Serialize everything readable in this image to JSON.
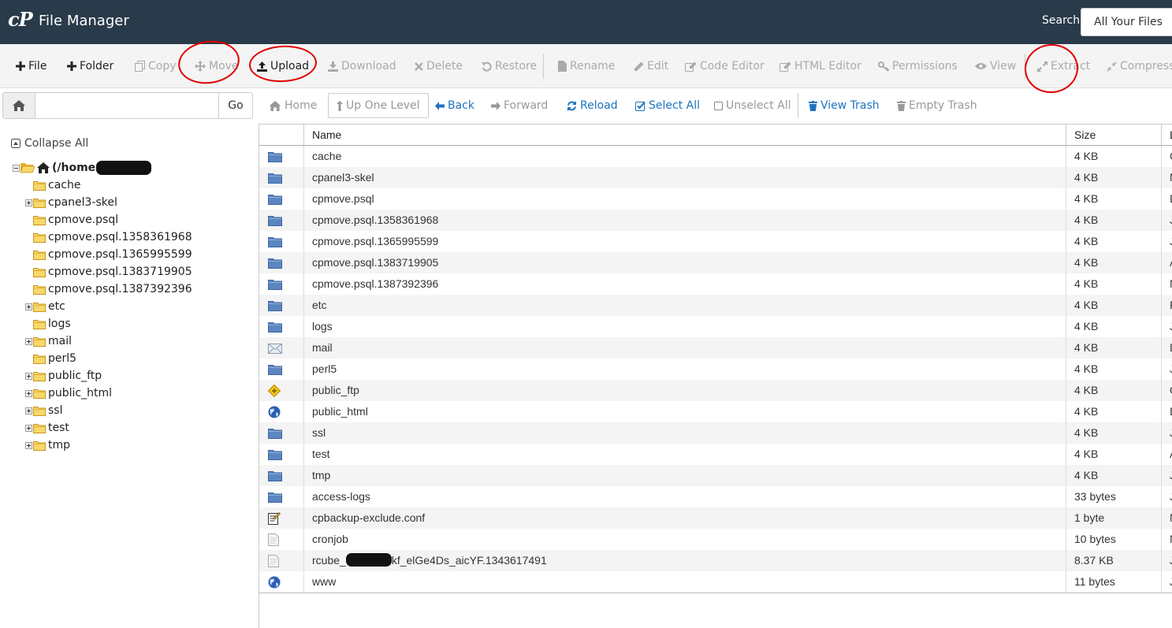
{
  "header": {
    "logo_text": "cP",
    "app_title": "File Manager",
    "search_label": "Search",
    "search_scope": "All Your Files"
  },
  "toolbar": [
    {
      "label": "File",
      "icon": "plus-icon",
      "enabled": true
    },
    {
      "label": "Folder",
      "icon": "plus-icon",
      "enabled": true
    },
    {
      "label": "Copy",
      "icon": "copy-icon",
      "enabled": false
    },
    {
      "label": "Move",
      "icon": "move-icon",
      "enabled": false
    },
    {
      "label": "Upload",
      "icon": "upload-icon",
      "enabled": true
    },
    {
      "label": "Download",
      "icon": "download-icon",
      "enabled": false
    },
    {
      "label": "Delete",
      "icon": "close-icon",
      "enabled": false
    },
    {
      "label": "Restore",
      "icon": "undo-icon",
      "enabled": false
    },
    {
      "label": "Rename",
      "icon": "file-icon",
      "enabled": false
    },
    {
      "label": "Edit",
      "icon": "pencil-icon",
      "enabled": false
    },
    {
      "label": "Code Editor",
      "icon": "edit-icon",
      "enabled": false
    },
    {
      "label": "HTML Editor",
      "icon": "edit-icon",
      "enabled": false
    },
    {
      "label": "Permissions",
      "icon": "key-icon",
      "enabled": false
    },
    {
      "label": "View",
      "icon": "eye-icon",
      "enabled": false
    },
    {
      "label": "Extract",
      "icon": "expand-icon",
      "enabled": false
    },
    {
      "label": "Compress",
      "icon": "compress-icon",
      "enabled": false
    }
  ],
  "path_bar": {
    "path_value": "",
    "go_label": "Go"
  },
  "nav": {
    "home": "Home",
    "up_one_level": "Up One Level",
    "back": "Back",
    "forward": "Forward",
    "reload": "Reload",
    "select_all": "Select All",
    "unselect_all": "Unselect All",
    "view_trash": "View Trash",
    "empty_trash": "Empty Trash"
  },
  "tree": {
    "collapse_all": "Collapse All",
    "root_label": "(/home",
    "items": [
      {
        "label": "cache",
        "expandable": false
      },
      {
        "label": "cpanel3-skel",
        "expandable": true
      },
      {
        "label": "cpmove.psql",
        "expandable": false
      },
      {
        "label": "cpmove.psql.1358361968",
        "expandable": false
      },
      {
        "label": "cpmove.psql.1365995599",
        "expandable": false
      },
      {
        "label": "cpmove.psql.1383719905",
        "expandable": false
      },
      {
        "label": "cpmove.psql.1387392396",
        "expandable": false
      },
      {
        "label": "etc",
        "expandable": true
      },
      {
        "label": "logs",
        "expandable": false
      },
      {
        "label": "mail",
        "expandable": true
      },
      {
        "label": "perl5",
        "expandable": false
      },
      {
        "label": "public_ftp",
        "expandable": true
      },
      {
        "label": "public_html",
        "expandable": true
      },
      {
        "label": "ssl",
        "expandable": true
      },
      {
        "label": "test",
        "expandable": true
      },
      {
        "label": "tmp",
        "expandable": true
      }
    ]
  },
  "table": {
    "columns": [
      "Name",
      "Size",
      "L"
    ],
    "rows": [
      {
        "icon": "folder-icon",
        "name": "cache",
        "size": "4 KB",
        "extra": "C"
      },
      {
        "icon": "folder-icon",
        "name": "cpanel3-skel",
        "size": "4 KB",
        "extra": "N"
      },
      {
        "icon": "folder-icon",
        "name": "cpmove.psql",
        "size": "4 KB",
        "extra": "D"
      },
      {
        "icon": "folder-icon",
        "name": "cpmove.psql.1358361968",
        "size": "4 KB",
        "extra": "J"
      },
      {
        "icon": "folder-icon",
        "name": "cpmove.psql.1365995599",
        "size": "4 KB",
        "extra": "J"
      },
      {
        "icon": "folder-icon",
        "name": "cpmove.psql.1383719905",
        "size": "4 KB",
        "extra": "A"
      },
      {
        "icon": "folder-icon",
        "name": "cpmove.psql.1387392396",
        "size": "4 KB",
        "extra": "N"
      },
      {
        "icon": "folder-icon",
        "name": "etc",
        "size": "4 KB",
        "extra": "F"
      },
      {
        "icon": "folder-icon",
        "name": "logs",
        "size": "4 KB",
        "extra": "J"
      },
      {
        "icon": "mail-icon",
        "name": "mail",
        "size": "4 KB",
        "extra": "D"
      },
      {
        "icon": "folder-icon",
        "name": "perl5",
        "size": "4 KB",
        "extra": "J"
      },
      {
        "icon": "ftp-icon",
        "name": "public_ftp",
        "size": "4 KB",
        "extra": "O"
      },
      {
        "icon": "globe-icon",
        "name": "public_html",
        "size": "4 KB",
        "extra": "D"
      },
      {
        "icon": "folder-icon",
        "name": "ssl",
        "size": "4 KB",
        "extra": "J"
      },
      {
        "icon": "folder-icon",
        "name": "test",
        "size": "4 KB",
        "extra": "A"
      },
      {
        "icon": "folder-icon",
        "name": "tmp",
        "size": "4 KB",
        "extra": "J"
      },
      {
        "icon": "folder-icon",
        "name": "access-logs",
        "size": "33 bytes",
        "extra": "J"
      },
      {
        "icon": "config-file-icon",
        "name": "cpbackup-exclude.conf",
        "size": "1 byte",
        "extra": "N"
      },
      {
        "icon": "text-file-icon",
        "name": "cronjob",
        "size": "10 bytes",
        "extra": "N"
      },
      {
        "icon": "text-file-icon",
        "name_prefix": "rcube_",
        "name_suffix": "kf_elGe4Ds_aicYF.1343617491",
        "redacted": true,
        "size": "8.37 KB",
        "extra": "J"
      },
      {
        "icon": "globe-icon",
        "name": "www",
        "size": "11 bytes",
        "extra": "J"
      }
    ]
  },
  "colors": {
    "header_bg": "#293a4a",
    "toolbar_bg": "#f4f4f4",
    "link_blue": "#1e73be",
    "annotation_red": "#e00000",
    "folder_blue": "#5b86c0",
    "folder_yellow": "#f2c84b"
  }
}
